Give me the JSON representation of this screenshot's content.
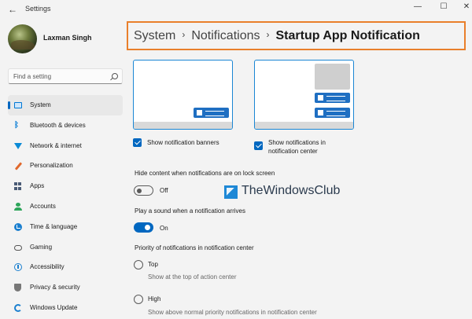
{
  "window": {
    "back_glyph": "←",
    "title": "Settings",
    "minimize": "—",
    "maximize": "☐",
    "close": "✕"
  },
  "user": {
    "name": "Laxman Singh"
  },
  "search": {
    "placeholder": "Find a setting"
  },
  "sidebar": {
    "items": [
      {
        "label": "System",
        "icon": "system-icon",
        "active": true
      },
      {
        "label": "Bluetooth & devices",
        "icon": "bluetooth-icon"
      },
      {
        "label": "Network & internet",
        "icon": "wifi-icon"
      },
      {
        "label": "Personalization",
        "icon": "brush-icon"
      },
      {
        "label": "Apps",
        "icon": "apps-icon"
      },
      {
        "label": "Accounts",
        "icon": "person-icon"
      },
      {
        "label": "Time & language",
        "icon": "globe-clock-icon"
      },
      {
        "label": "Gaming",
        "icon": "controller-icon"
      },
      {
        "label": "Accessibility",
        "icon": "accessibility-icon"
      },
      {
        "label": "Privacy & security",
        "icon": "shield-icon"
      },
      {
        "label": "Windows Update",
        "icon": "update-icon"
      }
    ]
  },
  "breadcrumb": {
    "parts": [
      "System",
      "Notifications"
    ],
    "separator": "›",
    "current": "Startup App Notification"
  },
  "options": {
    "banners": {
      "label": "Show notification banners",
      "checked": true
    },
    "center": {
      "label_line1": "Show notifications in",
      "label_line2": "notification center",
      "checked": true
    }
  },
  "lock_screen": {
    "label": "Hide content when notifications are on lock screen",
    "state": "Off",
    "on": false
  },
  "sound": {
    "label": "Play a sound when a notification arrives",
    "state": "On",
    "on": true
  },
  "priority": {
    "label": "Priority of notifications in notification center",
    "options": [
      {
        "label": "Top",
        "description": "Show at the top of action center",
        "selected": false
      },
      {
        "label": "High",
        "description": "Show above normal priority notifications in notification center",
        "selected": false
      }
    ]
  },
  "watermark": {
    "text": "TheWindowsClub"
  },
  "colors": {
    "accent": "#0067c0",
    "highlight_box": "#e97f2b"
  }
}
